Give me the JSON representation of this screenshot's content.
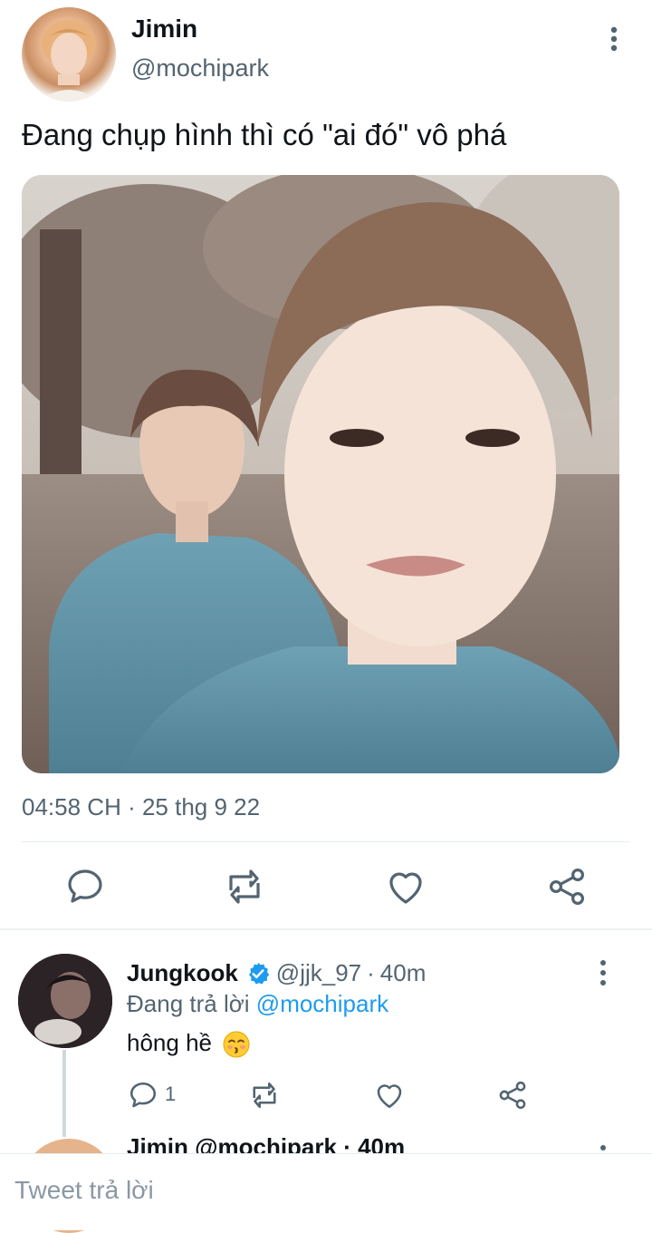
{
  "tweet": {
    "author_name": "Jimin",
    "author_handle": "@mochipark",
    "text": "Đang chụp hình thì có \"ai đó\" vô phá",
    "timestamp": "04:58 CH · 25 thg 9 22",
    "media": "photo",
    "actions": [
      "reply-icon",
      "retweet-icon",
      "like-icon",
      "share-icon"
    ]
  },
  "reply": {
    "author_name": "Jungkook",
    "verified": true,
    "author_handle": "@jjk_97",
    "separator": "·",
    "time": "40m",
    "replying_label": "Đang trả lời",
    "replying_handle": "@mochipark",
    "text": "hông hề",
    "emoji": "kissing-face-with-smiling-eyes",
    "reply_count": "1"
  },
  "next_reply_peek": {
    "text": "Jimin  @mochipark · 40m"
  },
  "composer": {
    "placeholder": "Tweet trả lời"
  },
  "colors": {
    "text_primary": "#0f1419",
    "text_secondary": "#536471",
    "accent_blue": "#1d9bf0",
    "divider": "#e6ecf0"
  }
}
